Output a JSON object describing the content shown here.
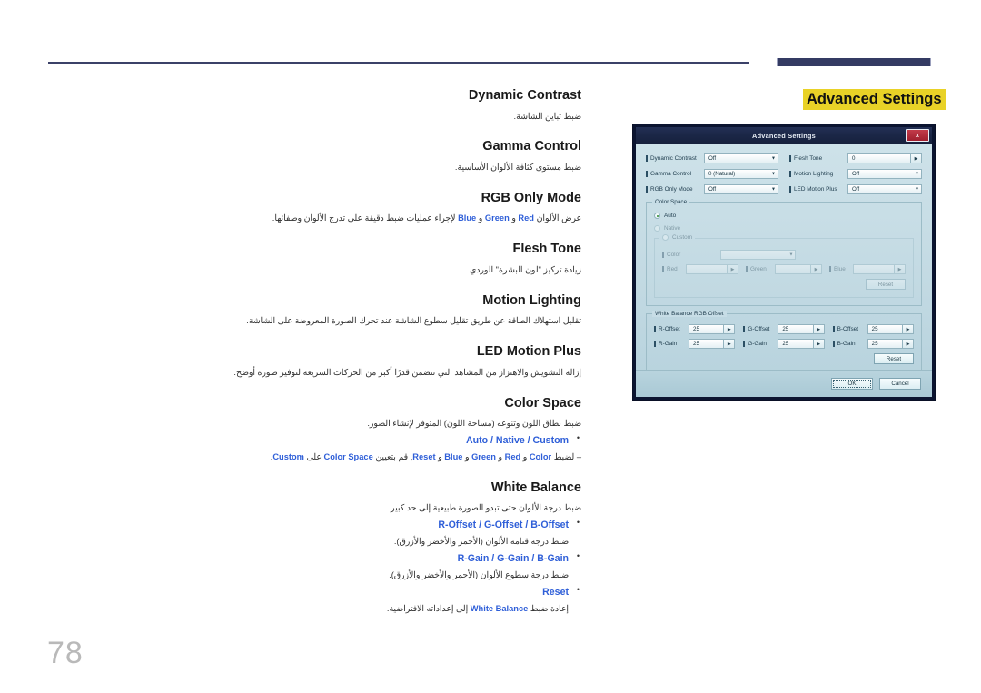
{
  "page": {
    "number": "78",
    "section_title": "Advanced Settings"
  },
  "entries": [
    {
      "term": "Dynamic Contrast",
      "desc": "ضبط تباين الشاشة."
    },
    {
      "term": "Gamma Control",
      "desc": "ضبط مستوى كثافة الألوان الأساسية."
    },
    {
      "term": "RGB Only Mode",
      "desc_before": "عرض الألوان ",
      "kw1": "Red",
      "mid1": " و ",
      "kw2": "Green",
      "mid2": " و ",
      "kw3": "Blue",
      "desc_after": " لإجراء عمليات ضبط دقيقة على تدرج الألوان وصفائها."
    },
    {
      "term": "Flesh Tone",
      "desc": "زيادة تركيز \"لون البشرة\" الوردي."
    },
    {
      "term": "Motion Lighting",
      "desc": "تقليل استهلاك الطاقة عن طريق تقليل سطوع الشاشة عند تحرك الصورة المعروضة على الشاشة."
    },
    {
      "term": "LED Motion Plus",
      "desc": "إزالة التشويش والاهتزاز من المشاهد التي تتضمن قدرًا أكبر من الحركات السريعة لتوفير صورة أوضح."
    }
  ],
  "color_space": {
    "term": "Color Space",
    "desc": "ضبط نطاق اللون وتنوعه (مساحة اللون) المتوفر لإنشاء الصور.",
    "options": "Auto / Native / Custom",
    "note_dash": "–",
    "note_pre": " لضبط ",
    "note_kw1": "Color",
    "note_mid1": " و ",
    "note_kw2": "Red",
    "note_mid2": " و ",
    "note_kw3": "Green",
    "note_mid3": " و ",
    "note_kw4": "Blue",
    "note_mid4": " و ",
    "note_kw5": "Reset",
    "note_mid5": ", قم بتعيين ",
    "note_kw6": "Color Space",
    "note_mid6": " على ",
    "note_kw7": "Custom",
    "note_end": "."
  },
  "white_balance": {
    "term": "White Balance",
    "desc": "ضبط درجة الألوان حتى تبدو الصورة طبيعية إلى حد كبير.",
    "items": [
      {
        "options": "R-Offset / G-Offset / B-Offset",
        "desc": "ضبط درجة قتامة الألوان (الأحمر والأخضر والأزرق)."
      },
      {
        "options": "R-Gain / G-Gain / B-Gain",
        "desc": "ضبط درجة سطوع الألوان (الأحمر والأخضر والأزرق)."
      },
      {
        "options": "Reset",
        "desc_pre": "إعادة ضبط ",
        "desc_kw": "White Balance",
        "desc_post": " إلى إعداداته الافتراضية."
      }
    ]
  },
  "dialog": {
    "title": "Advanced Settings",
    "close_label": "x",
    "fields": [
      {
        "label": "Dynamic Contrast",
        "value": "Off",
        "kind": "combo"
      },
      {
        "label": "Flesh Tone",
        "value": "0",
        "kind": "spin"
      },
      {
        "label": "Gamma Control",
        "value": "0 (Natural)",
        "kind": "combo"
      },
      {
        "label": "Motion Lighting",
        "value": "Off",
        "kind": "combo"
      },
      {
        "label": "RGB Only Mode",
        "value": "Off",
        "kind": "combo"
      },
      {
        "label": "LED Motion Plus",
        "value": "Off",
        "kind": "combo"
      }
    ],
    "color_space_group": {
      "legend": "Color Space",
      "radios": [
        {
          "label": "Auto",
          "selected": true
        },
        {
          "label": "Native",
          "selected": false
        },
        {
          "label": "Custom",
          "selected": false
        }
      ],
      "color_label": "Color",
      "color_value": "",
      "rgb": [
        {
          "label": "Red",
          "value": ""
        },
        {
          "label": "Green",
          "value": ""
        },
        {
          "label": "Blue",
          "value": ""
        }
      ],
      "reset_label": "Reset"
    },
    "wb_group": {
      "legend": "White Balance RGB Offset",
      "fields": [
        {
          "label": "R-Offset",
          "value": "25"
        },
        {
          "label": "G-Offset",
          "value": "25"
        },
        {
          "label": "B-Offset",
          "value": "25"
        },
        {
          "label": "R-Gain",
          "value": "25"
        },
        {
          "label": "G-Gain",
          "value": "25"
        },
        {
          "label": "B-Gain",
          "value": "25"
        }
      ],
      "reset_label": "Reset"
    },
    "ok_label": "OK",
    "cancel_label": "Cancel"
  }
}
